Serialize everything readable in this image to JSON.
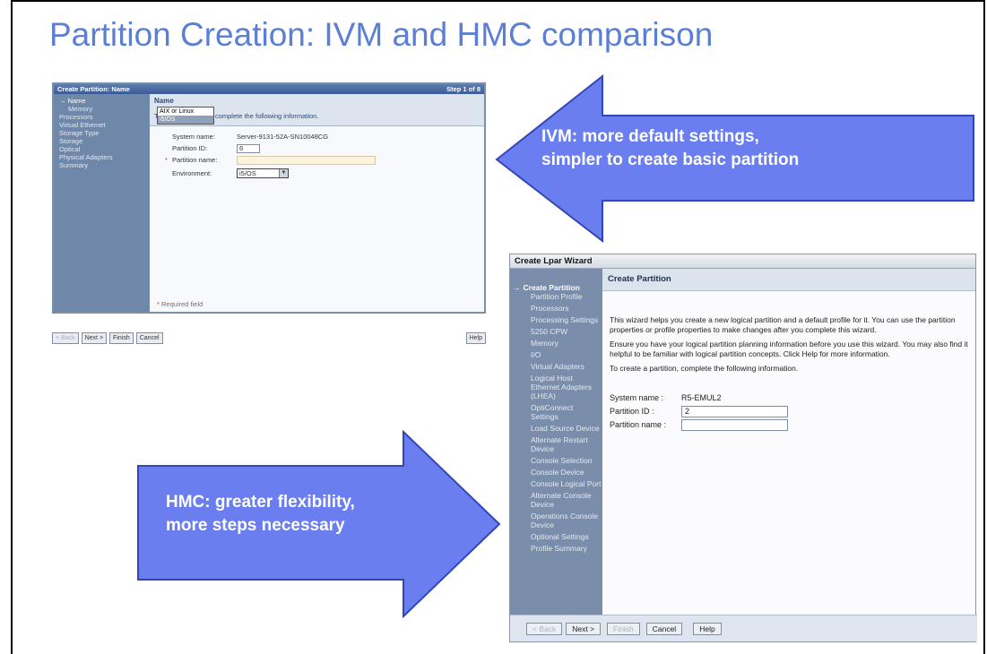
{
  "slide": {
    "title": "Partition Creation:  IVM and HMC comparison"
  },
  "colors": {
    "title": "#5b7fd4",
    "arrow_fill": "#6a7ef0",
    "arrow_stroke": "#3346b8"
  },
  "ivm": {
    "window_title": "Create Partition: Name",
    "step": "Step 1 of 8",
    "nav_items": [
      "Name",
      "Memory",
      "Processors",
      "Virtual Ethernet",
      "Storage Type",
      "Storage",
      "Optical",
      "Physical Adapters",
      "Summary"
    ],
    "heading": "Name",
    "description": "To create a partition complete the following information.",
    "system_name_label": "System name:",
    "system_name_value": "Server-9131-52A-SN10048CG",
    "partition_id_label": "Partition ID:",
    "partition_id_value": "6",
    "partition_name_label": "Partition name:",
    "environment_label": "Environment:",
    "environment_value": "i5/OS",
    "environment_options": [
      "AIX or Linux",
      "i5/OS"
    ],
    "required_note": "Required field",
    "buttons": {
      "back": "< Back",
      "next": "Next >",
      "finish": "Finish",
      "cancel": "Cancel",
      "help": "Help"
    }
  },
  "ivm_callout": {
    "line1": "IVM: more default settings,",
    "line2": "simpler to create basic partition"
  },
  "hmc": {
    "window_title": "Create Lpar Wizard",
    "heading": "Create Partition",
    "nav_items": [
      {
        "label": "Create Partition",
        "current": true
      },
      {
        "label": "Partition Profile"
      },
      {
        "label": "Processors"
      },
      {
        "label": "Processing Settings"
      },
      {
        "label": "5250 CPW"
      },
      {
        "label": "Memory"
      },
      {
        "label": "I/O"
      },
      {
        "label": "Virtual Adapters"
      },
      {
        "label": "Logical Host Ethernet Adapters (LHEA)"
      },
      {
        "label": "OptiConnect Settings"
      },
      {
        "label": "Load Source Device"
      },
      {
        "label": "Alternate Restart Device"
      },
      {
        "label": "Console Selection"
      },
      {
        "label": "Console Device"
      },
      {
        "label": "Console Logical Port"
      },
      {
        "label": "Alternate Console Device"
      },
      {
        "label": "Operations Console Device"
      },
      {
        "label": "Optional Settings"
      },
      {
        "label": "Profile Summary"
      }
    ],
    "para1": "This wizard helps you create a new logical partition and a default profile for it. You can use the partition properties or profile properties to make changes after you complete this wizard.",
    "para2": "Ensure you have your logical partition planning information before you use this wizard. You may also find it helpful to be familiar with logical partition concepts. Click Help for more information.",
    "para3": "To create a partition, complete the following information.",
    "system_name_label": "System name :",
    "system_name_value": "R5-EMUL2",
    "partition_id_label": "Partition ID :",
    "partition_id_value": "2",
    "partition_name_label": "Partition name :",
    "buttons": {
      "back": "< Back",
      "next": "Next >",
      "finish": "Finish",
      "cancel": "Cancel",
      "help": "Help"
    }
  },
  "hmc_callout": {
    "line1": "HMC: greater flexibility,",
    "line2": "more steps necessary"
  }
}
